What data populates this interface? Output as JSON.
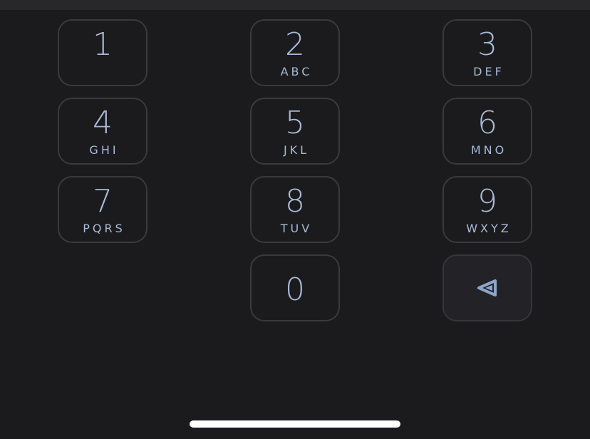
{
  "keypad": {
    "keys": [
      {
        "digit": "1",
        "letters": ""
      },
      {
        "digit": "2",
        "letters": "ABC"
      },
      {
        "digit": "3",
        "letters": "DEF"
      },
      {
        "digit": "4",
        "letters": "GHI"
      },
      {
        "digit": "5",
        "letters": "JKL"
      },
      {
        "digit": "6",
        "letters": "MNO"
      },
      {
        "digit": "7",
        "letters": "PQRS"
      },
      {
        "digit": "8",
        "letters": "TUV"
      },
      {
        "digit": "9",
        "letters": "WXYZ"
      },
      {
        "digit": "0",
        "letters": ""
      }
    ],
    "backspace_icon": "backspace-triangle-icon"
  },
  "colors": {
    "background": "#1b1b1d",
    "key_border": "#3a3a3d",
    "key_text": "#a9bad6",
    "backspace_fill": "#232327",
    "home_indicator": "#ffffff"
  }
}
